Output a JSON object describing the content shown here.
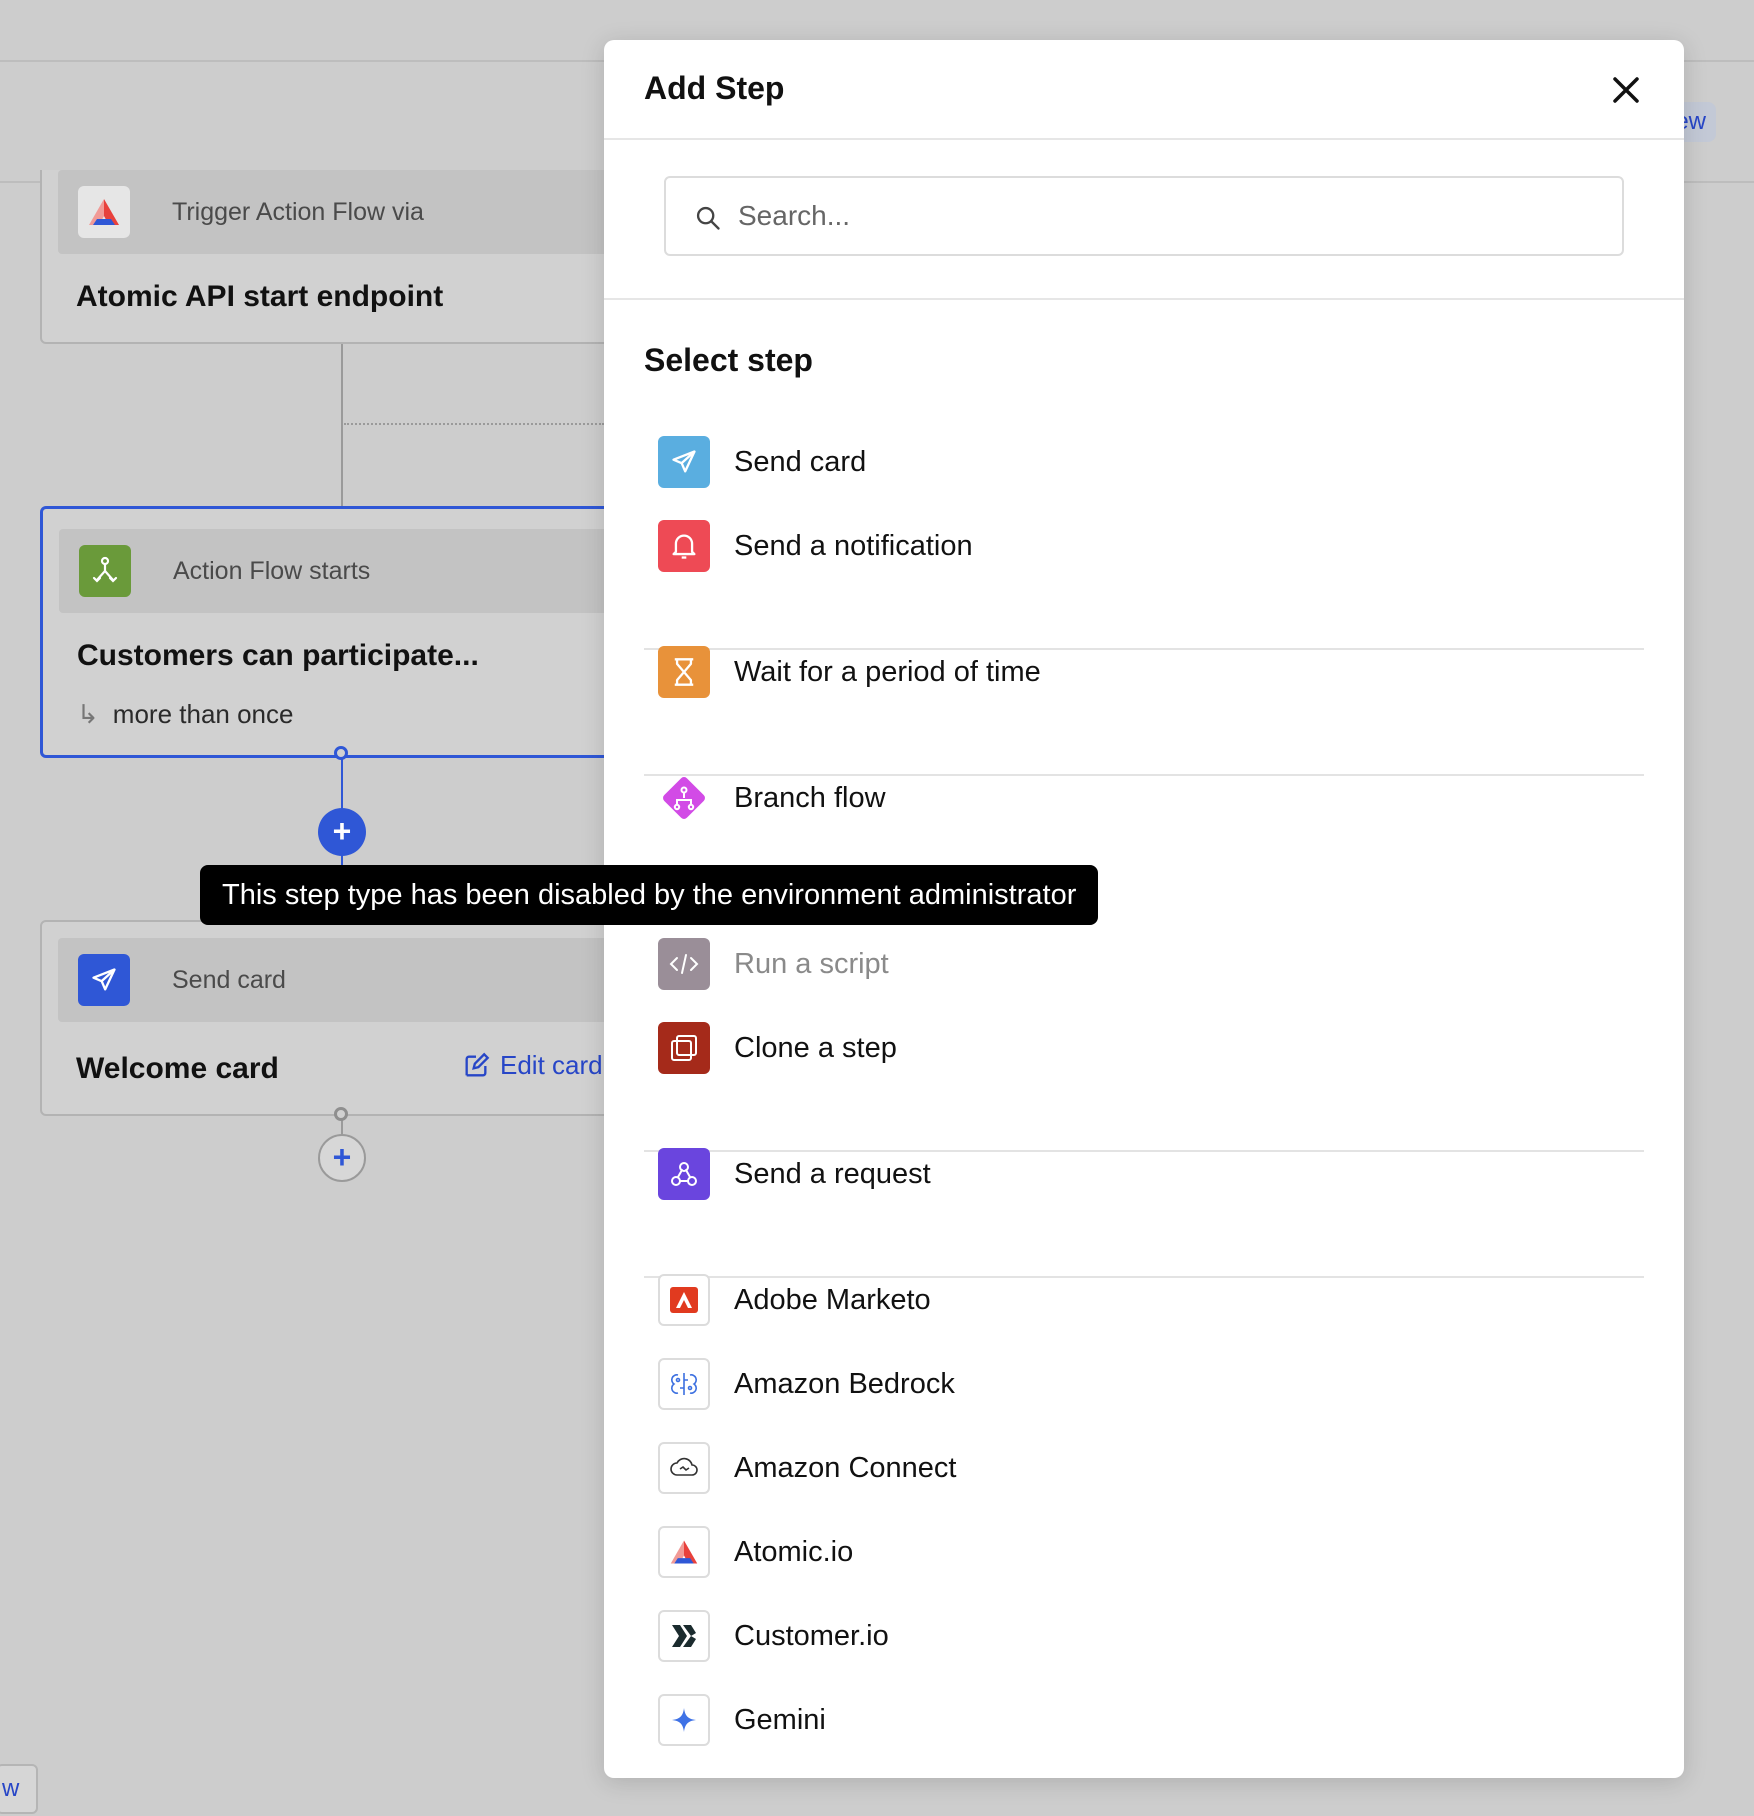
{
  "canvas": {
    "preview_chip": "ew",
    "bottom_chip": "w",
    "trigger_node": {
      "head_label": "Trigger Action Flow via",
      "title": "Atomic API start endpoint"
    },
    "start_node": {
      "head_label": "Action Flow starts",
      "title": "Customers can participate...",
      "subtitle": "more than once"
    },
    "card_node": {
      "head_label": "Send card",
      "title": "Welcome card",
      "edit_label": "Edit card"
    },
    "plus_symbol": "+"
  },
  "tooltip": {
    "text": "This step type has been disabled by the environment administrator"
  },
  "modal": {
    "title": "Add Step",
    "search": {
      "placeholder": "Search...",
      "value": ""
    },
    "section_title": "Select step",
    "steps": [
      {
        "label": "Send card",
        "icon": "paper-plane-icon",
        "color": "#5aaee0"
      },
      {
        "label": "Send a notification",
        "icon": "bell-icon",
        "color": "#ee4a55"
      },
      {
        "label": "Wait for a period of time",
        "icon": "hourglass-icon",
        "color": "#e8923a"
      },
      {
        "label": "Branch flow",
        "icon": "branch-icon",
        "color": "#d24be6"
      },
      {
        "label": "Run a script",
        "icon": "code-icon",
        "color": "#9a8e98",
        "disabled": true
      },
      {
        "label": "Clone a step",
        "icon": "clone-icon",
        "color": "#a52a1a"
      },
      {
        "label": "Send a request",
        "icon": "webhook-icon",
        "color": "#6a45de"
      },
      {
        "label": "Adobe Marketo",
        "icon": "adobe-icon",
        "color": "#e13a1f"
      },
      {
        "label": "Amazon Bedrock",
        "icon": "bedrock-icon",
        "color": "#3b6fe0"
      },
      {
        "label": "Amazon Connect",
        "icon": "cloud-icon",
        "color": "#333333"
      },
      {
        "label": "Atomic.io",
        "icon": "atomic-logo-icon",
        "color": "#e8413c"
      },
      {
        "label": "Customer.io",
        "icon": "customerio-icon",
        "color": "#1b2b2e"
      },
      {
        "label": "Gemini",
        "icon": "sparkle-icon",
        "color": "#3f72e6"
      }
    ],
    "hidden_green_step_color": "#4caa5c"
  }
}
